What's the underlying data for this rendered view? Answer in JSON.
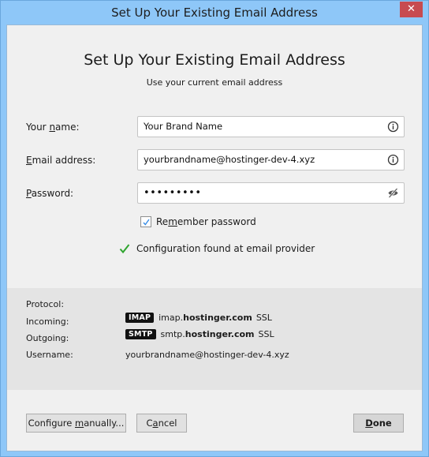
{
  "window": {
    "title": "Set Up Your Existing Email Address",
    "close_icon": "close-icon"
  },
  "header": {
    "title": "Set Up Your Existing Email Address",
    "subtitle": "Use your current email address"
  },
  "form": {
    "name": {
      "label_pre": "Your ",
      "label_key": "n",
      "label_post": "ame:",
      "value": "Your Brand Name",
      "icon": "info-icon"
    },
    "email": {
      "label_pre": "",
      "label_key": "E",
      "label_post": "mail address:",
      "value": "yourbrandname@hostinger-dev-4.xyz",
      "icon": "info-icon"
    },
    "password": {
      "label_pre": "",
      "label_key": "P",
      "label_post": "assword:",
      "value": "•••••••••",
      "icon": "eye-slash-icon"
    },
    "remember": {
      "label_pre": "Re",
      "label_key": "m",
      "label_post": "ember password",
      "checked": true
    }
  },
  "status": {
    "text": "Configuration found at email provider",
    "icon": "checkmark-icon",
    "color": "#2fa52f"
  },
  "details": {
    "protocol_label": "Protocol:",
    "incoming_label": "Incoming:",
    "outgoing_label": "Outgoing:",
    "username_label": "Username:",
    "incoming": {
      "badge": "IMAP",
      "host_prefix": "imap.",
      "host_domain": "hostinger.com",
      "security": "SSL"
    },
    "outgoing": {
      "badge": "SMTP",
      "host_prefix": "smtp.",
      "host_domain": "hostinger.com",
      "security": "SSL"
    },
    "username": "yourbrandname@hostinger-dev-4.xyz"
  },
  "buttons": {
    "configure": {
      "pre": "Configure ",
      "key": "m",
      "post": "anually..."
    },
    "cancel": {
      "pre": "C",
      "key": "a",
      "post": "ncel"
    },
    "done": {
      "pre": "",
      "key": "D",
      "post": "one"
    }
  }
}
